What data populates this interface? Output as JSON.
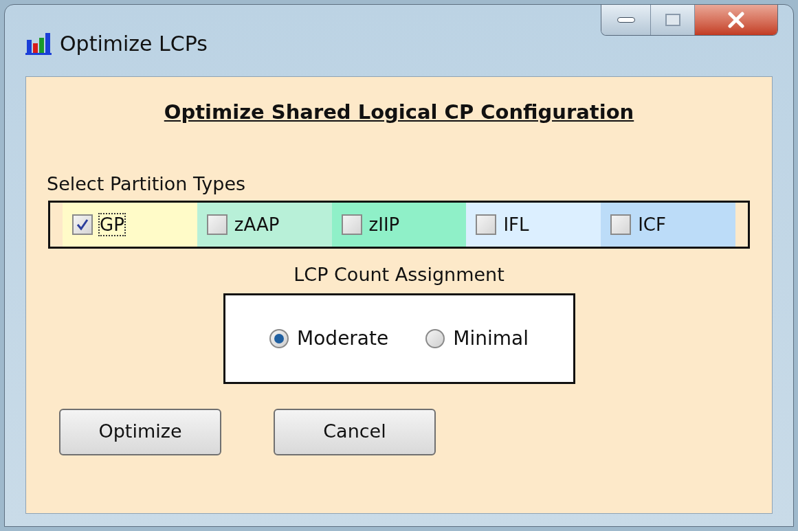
{
  "window": {
    "title": "Optimize LCPs"
  },
  "heading": "Optimize Shared Logical CP Configuration",
  "partition_types": {
    "label": "Select Partition Types",
    "items": [
      {
        "label": "GP",
        "checked": true,
        "focused": true,
        "color": "#fffbc8"
      },
      {
        "label": "zAAP",
        "checked": false,
        "focused": false,
        "color": "#b8f0d8"
      },
      {
        "label": "zIIP",
        "checked": false,
        "focused": false,
        "color": "#8ff0c8"
      },
      {
        "label": "IFL",
        "checked": false,
        "focused": false,
        "color": "#dcefff"
      },
      {
        "label": "ICF",
        "checked": false,
        "focused": false,
        "color": "#bcdcf8"
      }
    ]
  },
  "lcp_count": {
    "label": "LCP Count Assignment",
    "options": [
      {
        "label": "Moderate",
        "selected": true
      },
      {
        "label": "Minimal",
        "selected": false
      }
    ]
  },
  "buttons": [
    "Optimize",
    "Cancel"
  ]
}
